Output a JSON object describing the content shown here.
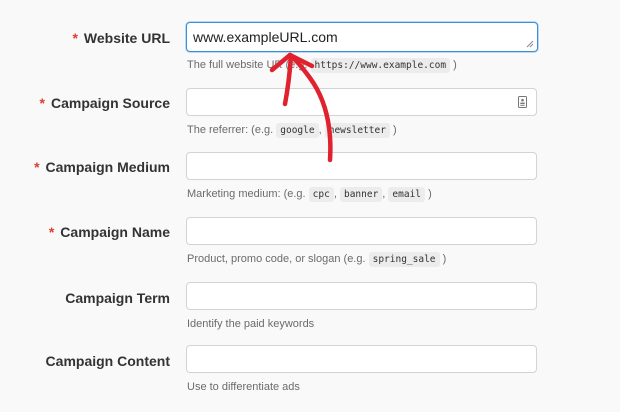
{
  "form": {
    "fields": [
      {
        "label": "Website URL",
        "required": true,
        "value": "www.exampleURL.com",
        "help_prefix": "The full website UR",
        "help_mid": "(e.g.",
        "help_code": "https://www.example.com",
        "help_suffix": ")"
      },
      {
        "label": "Campaign Source",
        "required": true,
        "value": "",
        "help_prefix": "The referrer: (e.g.",
        "help_code_1": "google",
        "help_sep": ",",
        "help_code_2": "newsletter",
        "help_suffix": ")"
      },
      {
        "label": "Campaign Medium",
        "required": true,
        "value": "",
        "help_prefix": "Marketing medium: (e.g.",
        "help_code_1": "cpc",
        "help_sep_1": ",",
        "help_code_2": "banner",
        "help_sep_2": ",",
        "help_code_3": "email",
        "help_suffix": ")"
      },
      {
        "label": "Campaign Name",
        "required": true,
        "value": "",
        "help_prefix": "Product, promo code, or slogan (e.g.",
        "help_code": "spring_sale",
        "help_suffix": ")"
      },
      {
        "label": "Campaign Term",
        "required": false,
        "value": "",
        "help": "Identify the paid keywords"
      },
      {
        "label": "Campaign Content",
        "required": false,
        "value": "",
        "help": "Use to differentiate ads"
      }
    ],
    "required_marker": "*"
  },
  "colors": {
    "background": "#f9f9f9",
    "required": "#e03c31",
    "focus_border": "#3b8fd6",
    "annotation_arrow": "#e0212e"
  },
  "icons": {
    "resize_grip": "resize-grip-icon",
    "autofill": "contact-card-icon",
    "annotation": "hand-drawn-arrow-icon"
  }
}
